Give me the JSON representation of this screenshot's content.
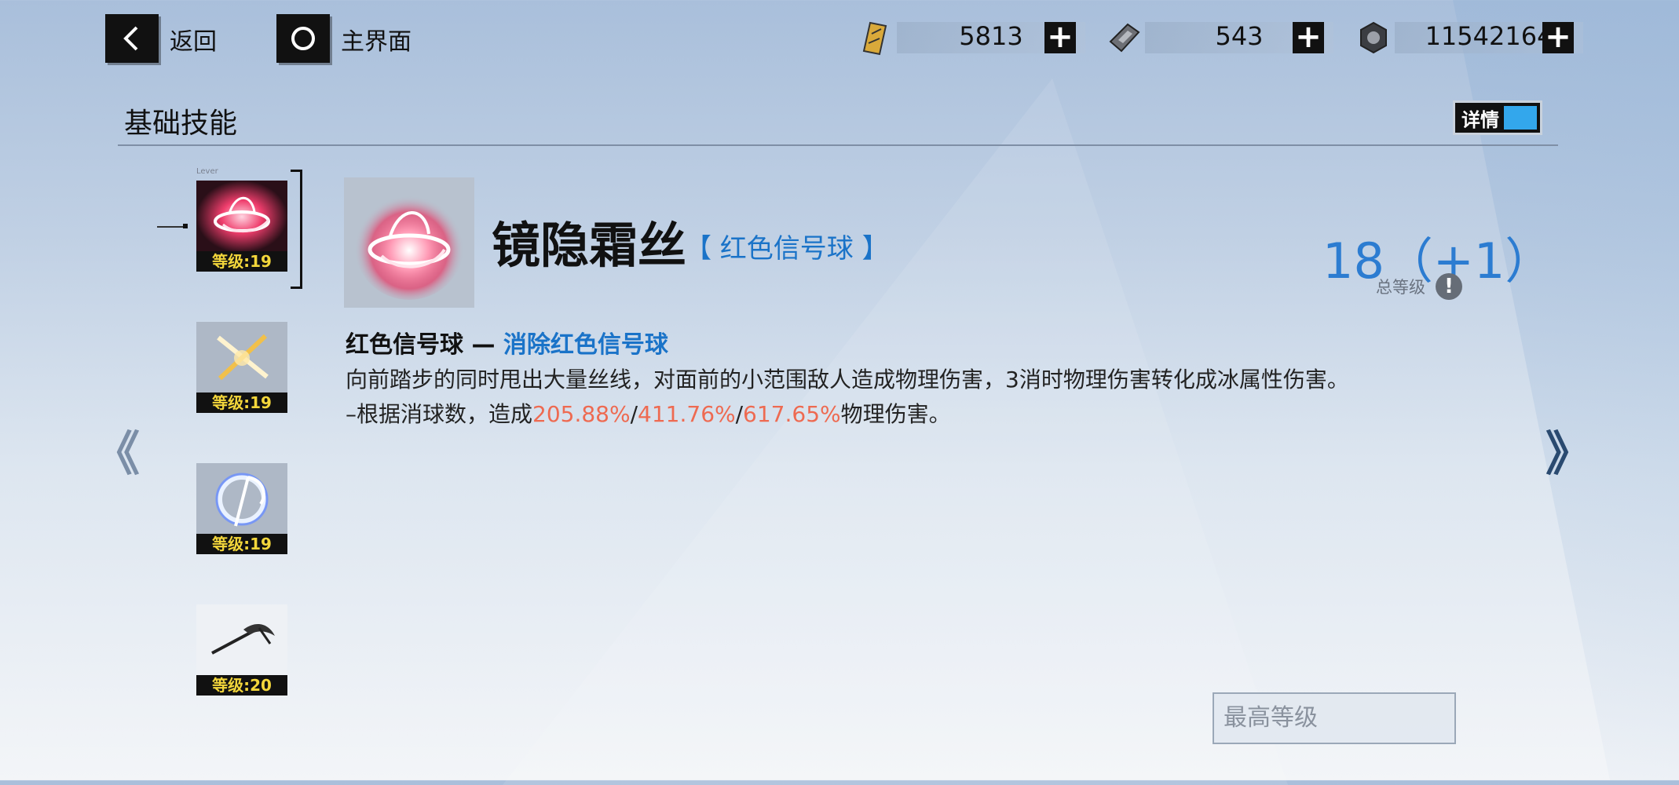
{
  "top_nav": {
    "back_label": "返回",
    "home_label": "主界面"
  },
  "resources": [
    {
      "icon": "gold-card-icon",
      "value": "5813"
    },
    {
      "icon": "chip-card-icon",
      "value": "543"
    },
    {
      "icon": "coin-icon",
      "value": "11542164"
    }
  ],
  "section": {
    "title": "基础技能",
    "detail_toggle_label": "详情"
  },
  "skill_list": [
    {
      "icon": "red-signal-orb-icon",
      "level_label": "等级:19",
      "selected": true
    },
    {
      "icon": "crossed-blades-icon",
      "level_label": "等级:19"
    },
    {
      "icon": "blue-scythe-icon",
      "level_label": "等级:19"
    },
    {
      "icon": "scythe-icon",
      "level_label": "等级:20"
    }
  ],
  "lever_label": "Lever",
  "selected_skill": {
    "name": "镜隐霜丝",
    "tag": "【 红色信号球 】",
    "total_level": "18（+1）",
    "total_level_label": "总等级",
    "info_icon": "!",
    "subtitle_prefix": "红色信号球 — ",
    "subtitle_effect": "消除红色信号球",
    "description_line1": "向前踏步的同时甩出大量丝线，对面前的小范围敌人造成物理伤害，3消时物理伤害转化成冰属性伤害。",
    "description_line2_prefix": "–根据消球数，造成",
    "damage_values": [
      "205.88%",
      "411.76%",
      "617.65%"
    ],
    "separator": "/",
    "description_line2_suffix": "物理伤害。"
  },
  "nav": {
    "prev": "《",
    "next": "》"
  },
  "max_level_button": "最高等级",
  "colors": {
    "accent_blue": "#2c7cd1",
    "damage_red": "#ee6a51",
    "level_yellow": "#f3d63b",
    "toggle_blue": "#33a7ec"
  }
}
